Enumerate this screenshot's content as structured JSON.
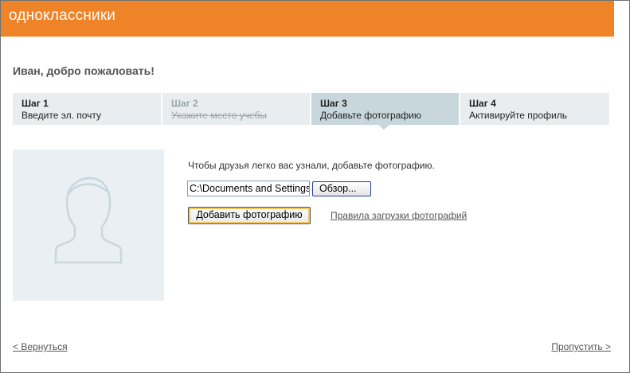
{
  "header": {
    "logo_text": "одноклассники",
    "color": "#ef8328"
  },
  "greeting": "Иван, добро пожаловать!",
  "steps": [
    {
      "title": "Шаг 1",
      "subtitle": "Введите эл. почту",
      "state": "normal"
    },
    {
      "title": "Шаг 2",
      "subtitle": "Укажите место учебы",
      "state": "done"
    },
    {
      "title": "Шаг 3",
      "subtitle": "Добавьте фотографию",
      "state": "active"
    },
    {
      "title": "Шаг 4",
      "subtitle": "Активируйте профиль",
      "state": "normal"
    }
  ],
  "photo": {
    "icon": "avatar-placeholder-icon"
  },
  "upload": {
    "hint": "Чтобы друзья легко вас узнали, добавьте фотографию.",
    "file_value": "C:\\Documents and Settings",
    "browse_label": "Обзор...",
    "add_label": "Добавить фотографию",
    "rules_link": "Правила загрузки фотографий"
  },
  "nav": {
    "back": "< Вернуться",
    "skip": "Пропустить >"
  }
}
